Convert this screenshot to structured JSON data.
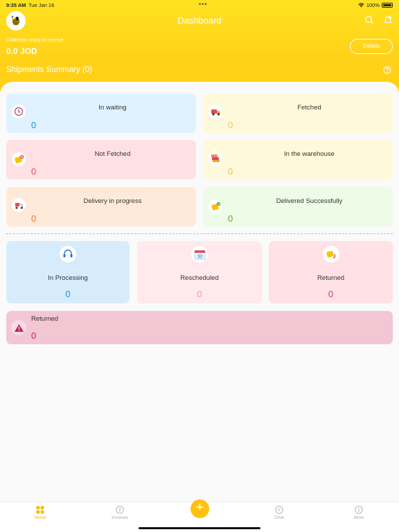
{
  "status_bar": {
    "time": "9:35 AM",
    "date": "Tue Jan 16",
    "dots": "•••",
    "battery": "100%"
  },
  "header": {
    "title": "Dashboard",
    "collection_label": "Collection ready to receive",
    "collection_value": "0.0 JOD",
    "details_label": "Details",
    "summary_title": "Shipments Summary (0)"
  },
  "cards": [
    {
      "label": "In waiting",
      "value": "0",
      "bg": "#e0f2ff",
      "num_color": "#1a8fcf"
    },
    {
      "label": "Fetched",
      "value": "0",
      "bg": "#fff9dc",
      "num_color": "#e6c84a"
    },
    {
      "label": "Not Fetched",
      "value": "0",
      "bg": "#ffe1e3",
      "num_color": "#e04a5a"
    },
    {
      "label": "In the warehouse",
      "value": "0",
      "bg": "#fff9dc",
      "num_color": "#e6c84a"
    },
    {
      "label": "Delivery in progress",
      "value": "0",
      "bg": "#ffead9",
      "num_color": "#e8782b"
    },
    {
      "label": "Delivered Successfully",
      "value": "0",
      "bg": "#eefbe6",
      "num_color": "#5ba83a"
    }
  ],
  "secondary_cards": [
    {
      "label": "In Processing",
      "value": "0",
      "bg": "#d6ecfd",
      "num_color": "#1a8fcf",
      "badge_text": ""
    },
    {
      "label": "Rescheduled",
      "value": "0",
      "bg": "#ffe9ec",
      "num_color": "#f09aa8",
      "badge_text": "30"
    },
    {
      "label": "Returned",
      "value": "0",
      "bg": "#ffe1e6",
      "num_color": "#d9386a",
      "badge_text": ""
    }
  ],
  "returned_bar": {
    "label": "Returned",
    "value": "0",
    "bg": "#f2c6d3",
    "num_color": "#c21e5a"
  },
  "tabs": [
    {
      "label": "Home",
      "icon": "home-grid-icon"
    },
    {
      "label": "Invoices",
      "icon": "invoice-icon"
    },
    {
      "label": "Chat",
      "icon": "chat-icon"
    },
    {
      "label": "More",
      "icon": "info-icon"
    }
  ],
  "plus_label": "+",
  "colors": {
    "brand": "#ffcf14",
    "accent": "#f5b800"
  }
}
